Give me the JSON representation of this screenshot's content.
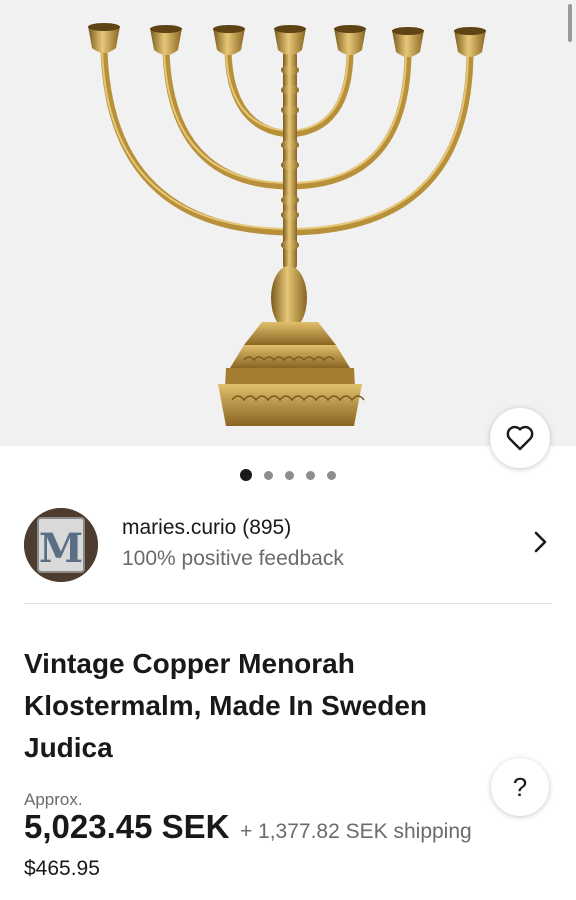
{
  "gallery": {
    "image_alt": "Brass seven-branch menorah",
    "dot_count": 5,
    "active_dot": 0,
    "favorite_icon": "heart-outline-icon"
  },
  "seller": {
    "avatar_letter": "M",
    "name": "maries.curio (895)",
    "feedback": "100% positive feedback",
    "chevron_icon": "chevron-right-icon"
  },
  "listing": {
    "title": "Vintage Copper Menorah Klostermalm, Made In Sweden Judica",
    "approx_label": "Approx.",
    "price": "5,023.45 SEK",
    "shipping": "+ 1,377.82 SEK shipping",
    "usd_price": "$465.95",
    "help_label": "?"
  },
  "colors": {
    "brass": "#b8903a",
    "brass_light": "#e6c777",
    "brass_dark": "#7a5a1c",
    "background": "#f1f1f1"
  }
}
